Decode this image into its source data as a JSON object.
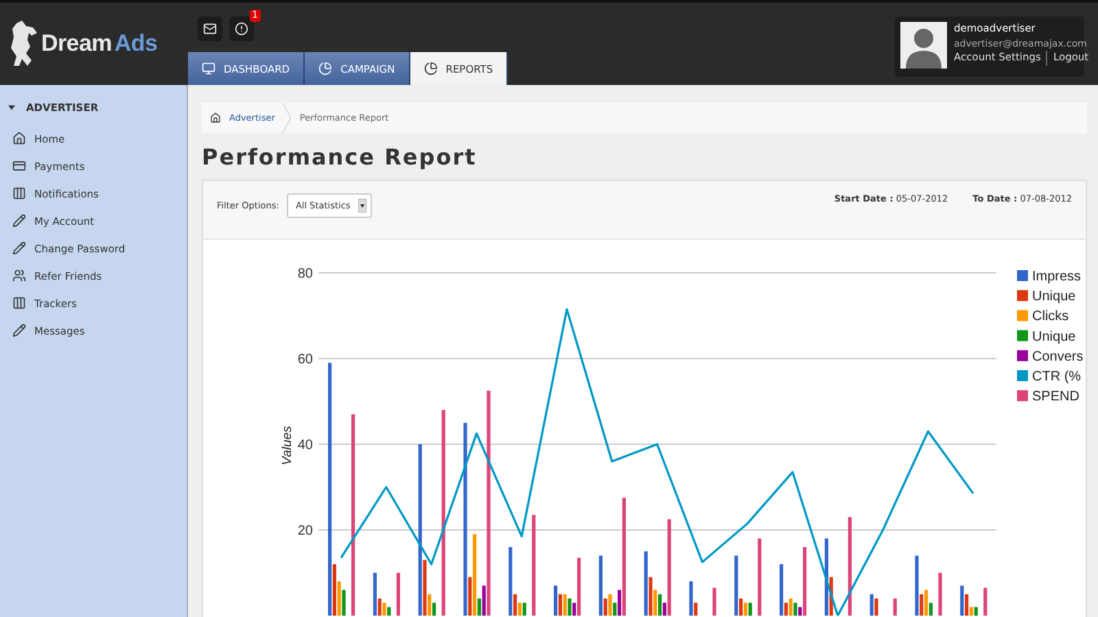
{
  "header": {
    "logo": {
      "first": "Dream",
      "second": "Ads"
    },
    "alert_badge": "1",
    "tabs": [
      {
        "label": "DASHBOARD",
        "selected": false
      },
      {
        "label": "CAMPAIGN",
        "selected": false
      },
      {
        "label": "REPORTS",
        "selected": true
      }
    ],
    "user": {
      "name": "demoadvertiser",
      "email": "advertiser@dreamajax.com",
      "links": [
        "Account Settings",
        "Logout"
      ]
    }
  },
  "sidebar": {
    "title": "ADVERTISER",
    "expanded": true,
    "items": [
      "Home",
      "Payments",
      "Notifications",
      "My Account",
      "Change Password",
      "Refer Friends",
      "Trackers",
      "Messages"
    ]
  },
  "breadcrumb": [
    "Advertiser",
    "Performance Report"
  ],
  "title": "Performance Report",
  "filter": {
    "label": "Filter Options:",
    "value": "All Statistics",
    "start_label": "Start Date :",
    "start": "05-07-2012",
    "end_label": "To Date :",
    "end": "07-08-2012"
  },
  "chart_data": {
    "type": "bar",
    "ylabel": "Values",
    "ylim": [
      0,
      80
    ],
    "yticks": [
      20,
      40,
      60,
      80
    ],
    "grid": true,
    "legend": "right",
    "series": [
      {
        "name": "Impress",
        "color": "#3366cc",
        "values": [
          59,
          10,
          40,
          45,
          16,
          7,
          14,
          15,
          8,
          14,
          12,
          18,
          5,
          14,
          7
        ]
      },
      {
        "name": "Unique",
        "color": "#dc3912",
        "values": [
          12,
          4,
          13,
          9,
          5,
          5,
          4,
          9,
          3,
          4,
          3,
          9,
          4,
          5,
          5
        ]
      },
      {
        "name": "Clicks",
        "color": "#ff9900",
        "values": [
          8,
          3,
          5,
          19,
          3,
          5,
          5,
          6,
          0,
          3,
          4,
          0,
          0,
          6,
          2
        ]
      },
      {
        "name": "Unique",
        "color": "#109618",
        "values": [
          6,
          2,
          3,
          4,
          3,
          4,
          3,
          5,
          0,
          3,
          3,
          0,
          0,
          3,
          2
        ]
      },
      {
        "name": "Convers",
        "color": "#990099",
        "values": [
          0,
          0,
          0,
          7,
          0,
          3,
          6,
          3,
          0,
          0,
          2,
          0,
          0,
          0,
          0
        ]
      },
      {
        "name": "CTR (%",
        "color": "#0099c6",
        "type": "line",
        "values": [
          13.5,
          30,
          12,
          42.5,
          18.5,
          71.5,
          36,
          40,
          12.5,
          21.5,
          33.5,
          0,
          20,
          43,
          28.5
        ]
      },
      {
        "name": "SPEND",
        "color": "#dd4477",
        "values": [
          47,
          10,
          48,
          52.5,
          23.5,
          13.5,
          27.5,
          22.5,
          6.5,
          18,
          16,
          23,
          4,
          10,
          6.5
        ]
      }
    ]
  }
}
